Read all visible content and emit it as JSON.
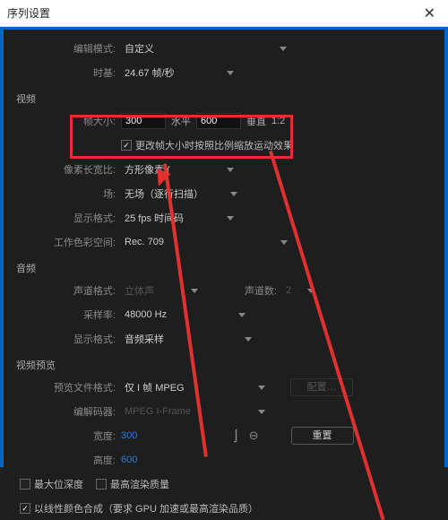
{
  "title": "序列设置",
  "general": {
    "edit_mode_label": "编辑模式:",
    "edit_mode_value": "自定义",
    "timebase_label": "时基:",
    "timebase_value": "24.67",
    "timebase_unit": "帧/秒"
  },
  "video": {
    "section": "视频",
    "frame_size_label": "帧大小:",
    "frame_w": "300",
    "horiz_label": "水平",
    "frame_h": "600",
    "vert_label": "垂直",
    "aspect_ratio": "1:2",
    "change_cb_label": "更改帧大小时按照比例缩放运动效果",
    "par_label": "像素长宽比:",
    "par_value": "方形像素 (",
    "fields_label": "场:",
    "fields_value": "无场（逐行扫描）",
    "display_fmt_label": "显示格式:",
    "display_fmt_value": "25 fps 时间码",
    "color_space_label": "工作色彩空间:",
    "color_space_value": "Rec. 709"
  },
  "audio": {
    "section": "音频",
    "ch_fmt_label": "声道格式:",
    "ch_fmt_value": "立体声",
    "ch_count_label": "声道数:",
    "ch_count_value": "2",
    "sample_rate_label": "采样率:",
    "sample_rate_value": "48000 Hz",
    "display_fmt_label": "显示格式:",
    "display_fmt_value": "音频采样"
  },
  "preview": {
    "section": "视频预览",
    "file_fmt_label": "预览文件格式:",
    "file_fmt_value": "仅 I 帧 MPEG",
    "config_btn": "配置…",
    "codec_label": "编解码器:",
    "codec_value": "MPEG I-Frame",
    "width_label": "宽度:",
    "width_value": "300",
    "height_label": "高度:",
    "height_value": "600",
    "reset_btn": "重置"
  },
  "footer": {
    "max_bit_label": "最大位深度",
    "max_render_label": "最高渲染质量",
    "linear_color_label": "以线性颜色合成（要求 GPU 加速或最高渲染品质）"
  }
}
